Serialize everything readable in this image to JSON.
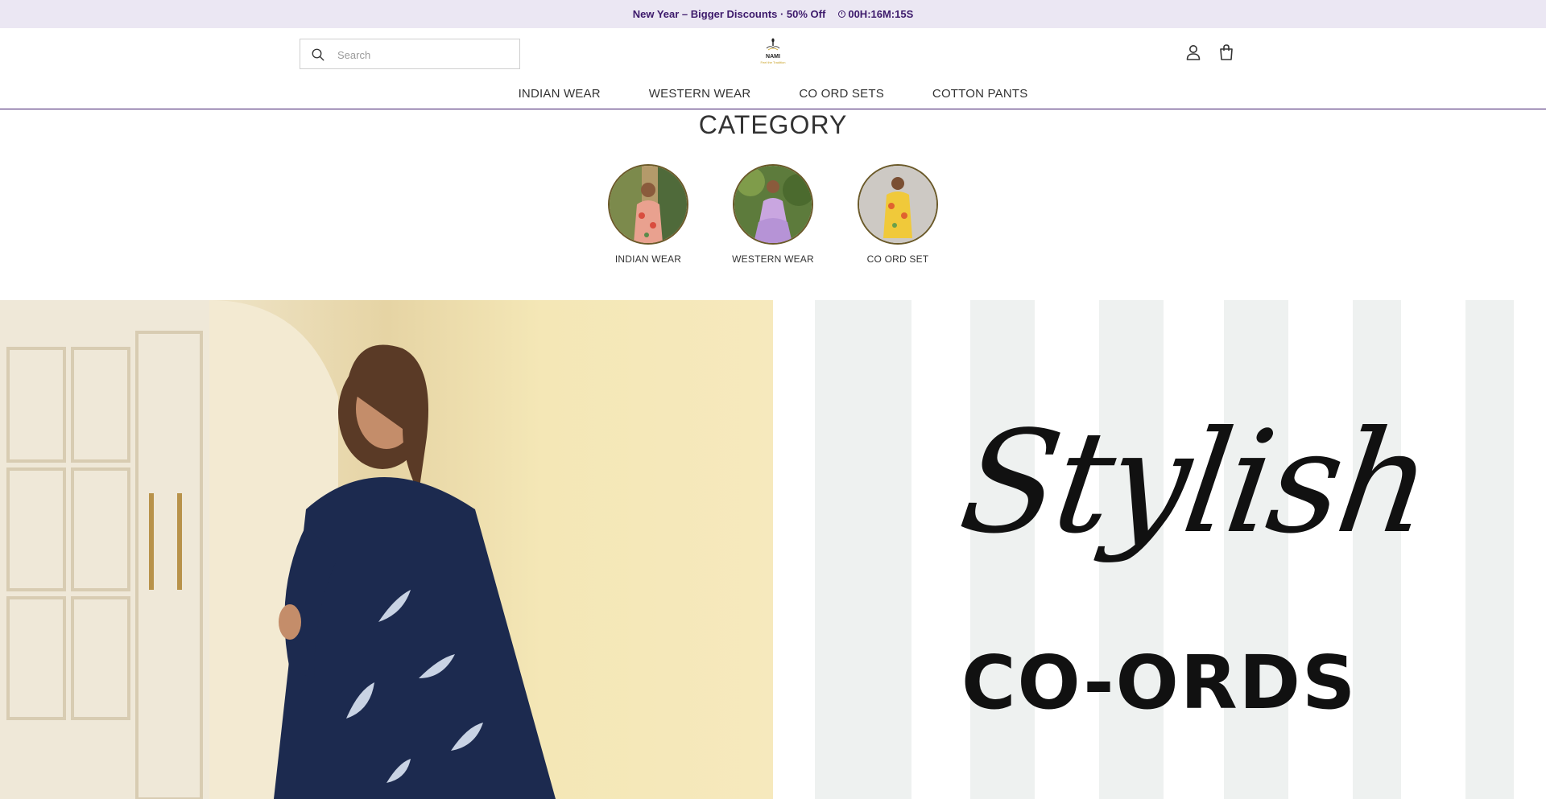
{
  "announcement": {
    "message": "New Year – Bigger Discounts · 50% Off",
    "timer": "00H:16M:15S",
    "timer_icon": "clock-icon"
  },
  "header": {
    "search": {
      "placeholder": "Search",
      "value": ""
    },
    "logo": {
      "brand": "NAMI",
      "tagline": "Feel the Tradition"
    },
    "icons": [
      "account-icon",
      "cart-icon"
    ]
  },
  "nav": {
    "items": [
      {
        "label": "INDIAN WEAR"
      },
      {
        "label": "WESTERN WEAR"
      },
      {
        "label": "CO ORD SETS"
      },
      {
        "label": "COTTON PANTS"
      }
    ]
  },
  "category": {
    "title": "CATEGORY",
    "items": [
      {
        "label": "INDIAN WEAR"
      },
      {
        "label": "WESTERN WEAR"
      },
      {
        "label": "CO ORD SET"
      }
    ]
  },
  "banner": {
    "script_text": "Stylish",
    "headline": "CO-ORDS"
  },
  "colors": {
    "accent": "#3d1a6b",
    "announcement_bg": "#ebe7f3",
    "text": "#333333"
  }
}
